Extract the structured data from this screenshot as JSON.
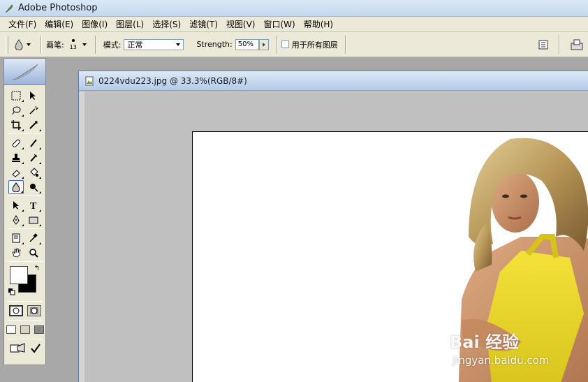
{
  "app": {
    "title": "Adobe Photoshop",
    "icon": "feather-icon"
  },
  "menu": [
    {
      "label": "文件(F)"
    },
    {
      "label": "编辑(E)"
    },
    {
      "label": "图像(I)"
    },
    {
      "label": "图层(L)"
    },
    {
      "label": "选择(S)"
    },
    {
      "label": "滤镜(T)"
    },
    {
      "label": "视图(V)"
    },
    {
      "label": "窗口(W)"
    },
    {
      "label": "帮助(H)"
    }
  ],
  "options": {
    "active_tool_icon": "blur-drop-icon",
    "brush_label": "画笔:",
    "brush_size": "13",
    "mode_label": "模式:",
    "mode_value": "正常",
    "strength_label": "Strength:",
    "strength_value": "50%",
    "all_layers_label": "用于所有图层"
  },
  "document": {
    "title": "0224vdu223.jpg @ 33.3%(RGB/8#)",
    "zoom": "33.3%",
    "color_mode": "RGB/8#"
  },
  "colors": {
    "foreground": "#ffffff",
    "background": "#000000",
    "accent": "#316ac5"
  },
  "watermark": {
    "brand": "Bai 经验",
    "url": "jingyan.baidu.com"
  }
}
